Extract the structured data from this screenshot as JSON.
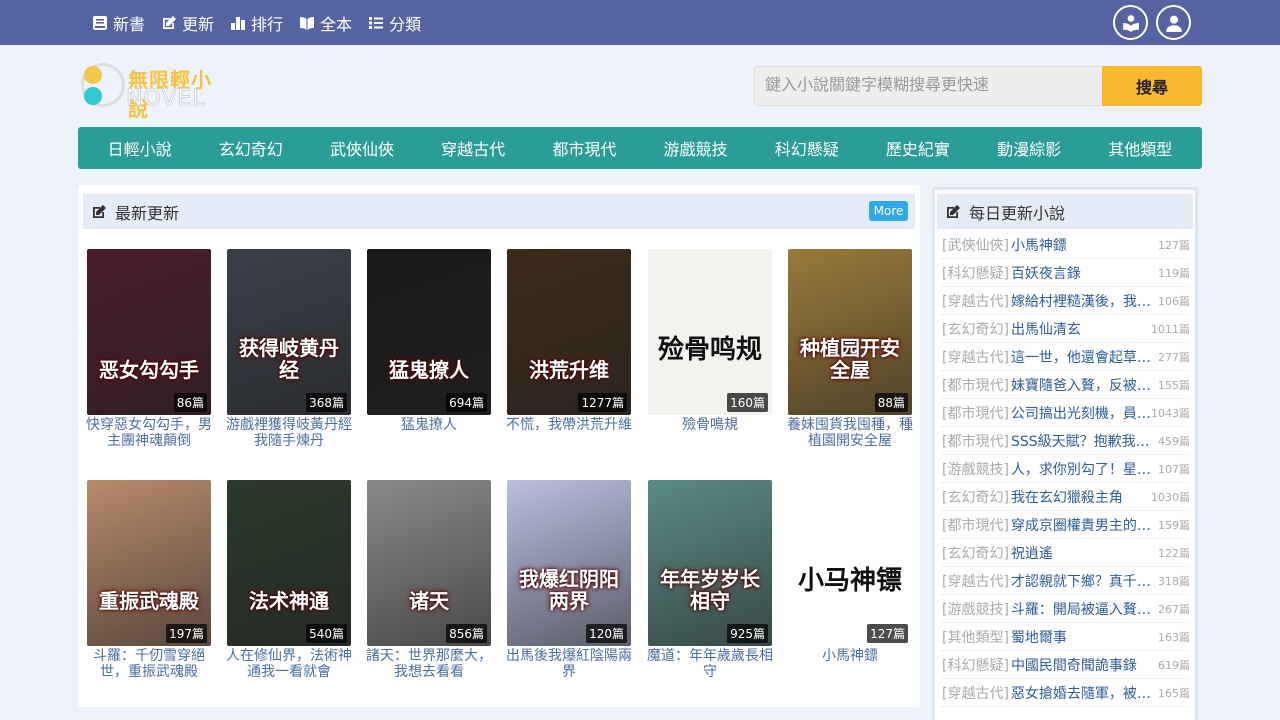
{
  "topnav": [
    {
      "label": "新書",
      "icon": "book-icon"
    },
    {
      "label": "更新",
      "icon": "edit-icon"
    },
    {
      "label": "排行",
      "icon": "bar-chart-icon"
    },
    {
      "label": "全本",
      "icon": "open-book-icon"
    },
    {
      "label": "分類",
      "icon": "list-icon"
    }
  ],
  "logo": {
    "cn": "無限輕小說",
    "en": "NOVEL"
  },
  "search": {
    "placeholder": "鍵入小說關鍵字模糊搜尋更快速",
    "button": "搜尋"
  },
  "categories": [
    "日輕小說",
    "玄幻奇幻",
    "武俠仙俠",
    "穿越古代",
    "都市現代",
    "游戲競技",
    "科幻懸疑",
    "歷史紀實",
    "動漫綜影",
    "其他類型"
  ],
  "latest": {
    "title": "最新更新",
    "more": "More",
    "books": [
      {
        "name": "快穿惡女勾勾手，男主團神魂顛倒",
        "count": "86篇",
        "cover_text": "恶女勾勾手",
        "bg": "#4a1b2c"
      },
      {
        "name": "游戲裡獲得岐黃丹經我隨手煉丹",
        "count": "368篇",
        "cover_text": "获得岐黄丹经",
        "bg": "#3a3f4a"
      },
      {
        "name": "猛鬼撩人",
        "count": "694篇",
        "cover_text": "猛鬼撩人",
        "bg": "#1a1a1a"
      },
      {
        "name": "不慌，我帶洪荒升維",
        "count": "1277篇",
        "cover_text": "洪荒升维",
        "bg": "#3c2a1a"
      },
      {
        "name": "殮骨鳴規",
        "count": "160篇",
        "cover_text": "殓骨鸣规",
        "bg": "#f4f2ee"
      },
      {
        "name": "養妹囤貨我囤種，種植園開安全屋",
        "count": "88篇",
        "cover_text": "种植园开安全屋",
        "bg": "#9a7a3a"
      },
      {
        "name": "斗羅：千仞雪穿絕世，重振武魂殿",
        "count": "197篇",
        "cover_text": "重振武魂殿",
        "bg": "#b88a6a"
      },
      {
        "name": "人在修仙界，法術神通我一看就會",
        "count": "540篇",
        "cover_text": "法术神通",
        "bg": "#2a3a2a"
      },
      {
        "name": "諸天：世界那麼大，我想去看看",
        "count": "856篇",
        "cover_text": "诸天",
        "bg": "#8a8a8a"
      },
      {
        "name": "出馬後我爆紅陰陽兩界",
        "count": "120篇",
        "cover_text": "我爆红阴阳两界",
        "bg": "#b9bfe0"
      },
      {
        "name": "魔道：年年歲歲長相守",
        "count": "925篇",
        "cover_text": "年年岁岁长相守",
        "bg": "#5a8a86"
      },
      {
        "name": "小馬神鏢",
        "count": "127篇",
        "cover_text": "小马神镖",
        "bg": "#ffffff"
      }
    ]
  },
  "daily": {
    "title": "每日更新小說",
    "items": [
      {
        "cat": "[武俠仙俠]",
        "name": "小馬神鏢",
        "count": "127篇"
      },
      {
        "cat": "[科幻懸疑]",
        "name": "百妖夜言錄",
        "count": "119篇"
      },
      {
        "cat": "[穿越古代]",
        "name": "嫁給村裡糙漢後，我…",
        "count": "106篇"
      },
      {
        "cat": "[玄幻奇幻]",
        "name": "出馬仙清玄",
        "count": "1011篇"
      },
      {
        "cat": "[穿越古代]",
        "name": "這一世，他還會起草…",
        "count": "277篇"
      },
      {
        "cat": "[都市現代]",
        "name": "妹寶隨爸入贅，反被…",
        "count": "155篇"
      },
      {
        "cat": "[都市現代]",
        "name": "公司搞出光刻機，員…",
        "count": "1043篇"
      },
      {
        "cat": "[都市現代]",
        "name": "SSS級天賦？抱歉我…",
        "count": "459篇"
      },
      {
        "cat": "[游戲競技]",
        "name": "人，求你別勾了！星…",
        "count": "107篇"
      },
      {
        "cat": "[玄幻奇幻]",
        "name": "我在玄幻獵殺主角",
        "count": "1030篇"
      },
      {
        "cat": "[都市現代]",
        "name": "穿成京圈權貴男主的…",
        "count": "159篇"
      },
      {
        "cat": "[玄幻奇幻]",
        "name": "祝逍遙",
        "count": "122篇"
      },
      {
        "cat": "[穿越古代]",
        "name": "才認親就下鄉？真千…",
        "count": "318篇"
      },
      {
        "cat": "[游戲競技]",
        "name": "斗羅：開局被逼入贅…",
        "count": "267篇"
      },
      {
        "cat": "[其他類型]",
        "name": "蜀地爾事",
        "count": "163篇"
      },
      {
        "cat": "[科幻懸疑]",
        "name": "中國民間奇聞詭事錄",
        "count": "619篇"
      },
      {
        "cat": "[穿越古代]",
        "name": "惡女搶婚去隨軍，被…",
        "count": "165篇"
      }
    ]
  }
}
